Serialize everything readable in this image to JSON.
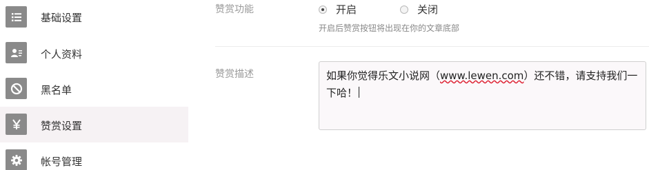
{
  "sidebar": {
    "items": [
      {
        "label": "基础设置",
        "icon": "list-icon",
        "active": false
      },
      {
        "label": "个人资料",
        "icon": "profile-card-icon",
        "active": false
      },
      {
        "label": "黑名单",
        "icon": "blocked-icon",
        "active": false
      },
      {
        "label": "赞赏设置",
        "icon": "yen-icon",
        "active": true
      },
      {
        "label": "帐号管理",
        "icon": "gear-icon",
        "active": false
      }
    ],
    "active_bg": "#f6f2f4",
    "icon_bg": "#8a8a8a"
  },
  "reward": {
    "toggle_label": "赞赏功能",
    "option_on": "开启",
    "option_off": "关闭",
    "selected": "开启",
    "hint": "开启后赞赏按钮将出现在你的文章底部",
    "description_label": "赞赏描述",
    "description_before_link": "如果你觉得乐文小说网（",
    "description_link": "www.lewen.com",
    "description_after_link": "）还不错，请支持我们一下哈！"
  }
}
